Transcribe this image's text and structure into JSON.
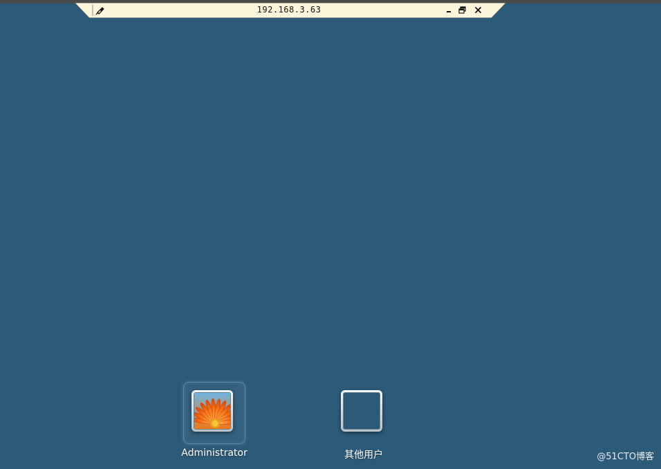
{
  "connection_bar": {
    "title": "192.168.3.63",
    "pin_icon": "pin-icon",
    "minimize_icon": "minimize-icon",
    "restore_icon": "restore-icon",
    "close_icon": "close-icon",
    "bar_color": "#fbf6dc"
  },
  "desktop": {
    "background_color": "#2c5b79"
  },
  "users": [
    {
      "name": "Administrator",
      "avatar": "flower-avatar",
      "selected": true
    },
    {
      "name": "其他用户",
      "avatar": "empty-avatar",
      "selected": false
    }
  ],
  "watermark": "@51CTO博客"
}
